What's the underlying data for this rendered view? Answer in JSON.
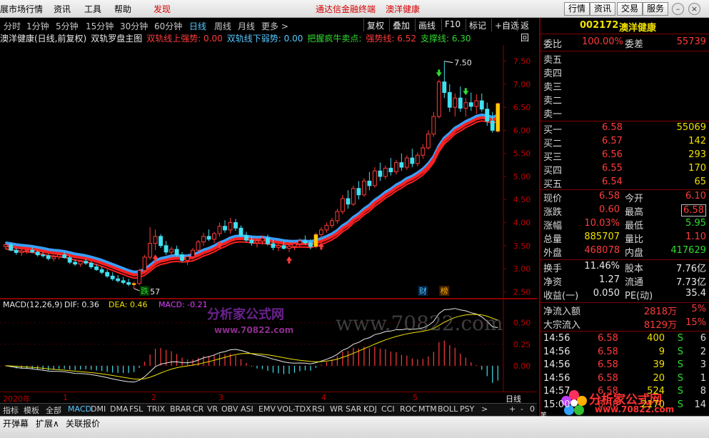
{
  "menu": {
    "items": [
      "展市场行情",
      "资讯",
      "工具",
      "帮助"
    ],
    "discover": "发现",
    "app_title": "通达信金融终端",
    "stock_title": "澳洋健康",
    "right_buttons": [
      "行情",
      "资讯",
      "交易",
      "服务"
    ]
  },
  "periods": {
    "items": [
      "分时",
      "1分钟",
      "5分钟",
      "15分钟",
      "30分钟",
      "60分钟",
      "日线",
      "周线",
      "月线",
      "更多 >"
    ],
    "active": "日线",
    "toolbar": [
      "复权",
      "叠加",
      "画线",
      "F10",
      "标记",
      "+自选",
      "返回"
    ]
  },
  "chart_title": {
    "name": "澳洋健康(日线,前复权)",
    "indicator": "双轨罗盘主图",
    "items": [
      {
        "text": "双轨线上强势: 0.00",
        "color": "#ff3b3b"
      },
      {
        "text": "双轨线下弱势: 0.00",
        "color": "#56c8ff"
      },
      {
        "text": "把握疯牛卖点:",
        "color": "#2fdc2f"
      },
      {
        "text": "强势线: 6.52",
        "color": "#ff3b3b"
      },
      {
        "text": "支撑线: 6.30",
        "color": "#2fdc2f"
      }
    ]
  },
  "chart_data": [
    {
      "type": "candlestick",
      "yticks": [
        "7.50",
        "7.00",
        "6.50",
        "6.00",
        "5.50",
        "5.00",
        "4.50",
        "4.00",
        "3.50",
        "3.00",
        "2.50"
      ],
      "ylim": [
        2.35,
        7.85
      ],
      "annotations": {
        "high": "7.50",
        "low": "2.57"
      },
      "markers": [
        "跌",
        "财",
        "榜"
      ],
      "candles": [
        [
          3.48,
          3.58,
          3.42,
          3.52
        ],
        [
          3.52,
          3.56,
          3.38,
          3.4
        ],
        [
          3.4,
          3.45,
          3.3,
          3.35
        ],
        [
          3.35,
          3.42,
          3.28,
          3.38
        ],
        [
          3.38,
          3.44,
          3.32,
          3.4
        ],
        [
          3.4,
          3.46,
          3.34,
          3.36
        ],
        [
          3.36,
          3.4,
          3.26,
          3.3
        ],
        [
          3.3,
          3.36,
          3.24,
          3.28
        ],
        [
          3.28,
          3.32,
          3.18,
          3.22
        ],
        [
          3.22,
          3.3,
          3.16,
          3.26
        ],
        [
          3.26,
          3.34,
          3.2,
          3.3
        ],
        [
          3.3,
          3.36,
          3.22,
          3.24
        ],
        [
          3.24,
          3.28,
          3.1,
          3.14
        ],
        [
          3.14,
          3.2,
          3.06,
          3.1
        ],
        [
          3.1,
          3.18,
          3.04,
          3.16
        ],
        [
          3.16,
          3.22,
          3.08,
          3.12
        ],
        [
          3.12,
          3.16,
          3.0,
          3.04
        ],
        [
          3.04,
          3.1,
          2.95,
          2.98
        ],
        [
          2.98,
          3.04,
          2.88,
          2.92
        ],
        [
          2.92,
          2.98,
          2.8,
          2.84
        ],
        [
          2.84,
          2.92,
          2.74,
          2.78
        ],
        [
          2.78,
          2.86,
          2.7,
          2.74
        ],
        [
          2.74,
          2.82,
          2.66,
          2.7
        ],
        [
          2.7,
          2.78,
          2.62,
          2.66
        ],
        [
          2.66,
          2.72,
          2.57,
          2.68
        ],
        [
          2.68,
          3.0,
          2.64,
          2.96
        ],
        [
          2.96,
          3.3,
          2.92,
          3.25
        ],
        [
          3.25,
          3.9,
          3.2,
          3.55
        ],
        [
          3.55,
          3.85,
          3.4,
          3.7
        ],
        [
          3.7,
          3.75,
          3.45,
          3.5
        ],
        [
          3.5,
          3.6,
          3.3,
          3.36
        ],
        [
          3.36,
          3.48,
          3.2,
          3.42
        ],
        [
          3.42,
          3.5,
          3.26,
          3.3
        ],
        [
          3.3,
          3.36,
          3.14,
          3.18
        ],
        [
          3.18,
          3.3,
          3.08,
          3.26
        ],
        [
          3.26,
          3.45,
          3.2,
          3.4
        ],
        [
          3.4,
          3.62,
          3.36,
          3.58
        ],
        [
          3.58,
          3.78,
          3.5,
          3.7
        ],
        [
          3.7,
          3.85,
          3.6,
          3.64
        ],
        [
          3.64,
          3.8,
          3.56,
          3.76
        ],
        [
          3.76,
          4.0,
          3.7,
          3.92
        ],
        [
          3.92,
          4.05,
          3.78,
          3.84
        ],
        [
          3.84,
          4.1,
          3.76,
          4.0
        ],
        [
          4.0,
          4.08,
          3.82,
          3.88
        ],
        [
          3.88,
          3.94,
          3.68,
          3.72
        ],
        [
          3.72,
          3.8,
          3.58,
          3.62
        ],
        [
          3.62,
          3.7,
          3.5,
          3.56
        ],
        [
          3.56,
          3.66,
          3.46,
          3.6
        ],
        [
          3.6,
          3.72,
          3.52,
          3.66
        ],
        [
          3.66,
          3.74,
          3.5,
          3.54
        ],
        [
          3.54,
          3.62,
          3.4,
          3.46
        ],
        [
          3.46,
          3.56,
          3.38,
          3.5
        ],
        [
          3.5,
          3.6,
          3.42,
          3.44
        ],
        [
          3.44,
          3.52,
          3.36,
          3.48
        ],
        [
          3.48,
          3.58,
          3.4,
          3.54
        ],
        [
          3.54,
          3.66,
          3.48,
          3.6
        ],
        [
          3.6,
          3.72,
          3.52,
          3.56
        ],
        [
          3.56,
          3.64,
          3.42,
          3.48
        ],
        [
          3.48,
          3.78,
          3.44,
          3.74
        ],
        [
          3.74,
          3.9,
          3.66,
          3.84
        ],
        [
          3.84,
          4.0,
          3.78,
          3.94
        ],
        [
          3.94,
          4.1,
          3.88,
          4.04
        ],
        [
          4.04,
          4.3,
          3.98,
          4.24
        ],
        [
          4.24,
          4.6,
          4.18,
          4.52
        ],
        [
          4.52,
          4.7,
          4.3,
          4.4
        ],
        [
          4.4,
          4.8,
          4.36,
          4.74
        ],
        [
          4.74,
          4.9,
          4.5,
          4.6
        ],
        [
          4.6,
          4.96,
          4.56,
          4.9
        ],
        [
          4.9,
          5.1,
          4.7,
          4.8
        ],
        [
          4.8,
          5.2,
          4.76,
          5.12
        ],
        [
          5.12,
          5.3,
          4.9,
          5.0
        ],
        [
          5.0,
          5.24,
          4.94,
          5.18
        ],
        [
          5.18,
          5.4,
          5.02,
          5.1
        ],
        [
          5.1,
          5.36,
          5.04,
          5.3
        ],
        [
          5.3,
          5.5,
          5.12,
          5.2
        ],
        [
          5.2,
          5.46,
          5.14,
          5.4
        ],
        [
          5.4,
          5.6,
          5.2,
          5.28
        ],
        [
          5.28,
          5.52,
          5.22,
          5.46
        ],
        [
          5.46,
          5.7,
          5.38,
          5.62
        ],
        [
          5.62,
          6.0,
          5.58,
          5.92
        ],
        [
          5.92,
          6.4,
          5.86,
          6.3
        ],
        [
          6.3,
          7.1,
          6.26,
          7.05
        ],
        [
          7.05,
          7.5,
          6.7,
          6.82
        ],
        [
          6.82,
          7.0,
          6.4,
          6.5
        ],
        [
          6.5,
          6.8,
          6.3,
          6.7
        ],
        [
          6.7,
          6.95,
          6.4,
          6.48
        ],
        [
          6.48,
          6.7,
          6.3,
          6.6
        ],
        [
          6.6,
          6.82,
          6.42,
          6.52
        ],
        [
          6.52,
          6.78,
          6.36,
          6.64
        ],
        [
          6.64,
          6.8,
          6.4,
          6.46
        ],
        [
          6.46,
          6.6,
          6.1,
          6.2
        ],
        [
          6.2,
          6.4,
          5.95,
          6.0
        ],
        [
          5.98,
          6.6,
          5.95,
          6.58
        ]
      ]
    },
    {
      "type": "bar",
      "title": "MACD(12,26,9)",
      "series_labels": [
        {
          "text": "MACD(12,26,9)",
          "color": "#e8e8e8"
        },
        {
          "text": "DIF: 0.36",
          "color": "#e8e8e8"
        },
        {
          "text": "DEA: 0.46",
          "color": "#f0e000"
        },
        {
          "text": "MACD: -0.21",
          "color": "#e040ff"
        }
      ],
      "yticks": [
        "0.50",
        "0.25",
        "0.00"
      ],
      "ylim": [
        -0.3,
        0.78
      ]
    }
  ],
  "date_axis": {
    "year_label": "2020年",
    "months": [
      "1",
      "2",
      "3",
      "4",
      "5"
    ],
    "period_label": "日线"
  },
  "indicators": {
    "items": [
      "指标",
      "模板",
      "全部",
      "MACD",
      "DMI",
      "DMA",
      "FSL",
      "TRIX",
      "BRAR",
      "CR",
      "VR",
      "OBV",
      "ASI",
      "EMV",
      "VOL-TDX",
      "RSI",
      "WR",
      "SAR",
      "KDJ",
      "CCI",
      "ROC",
      "MTM",
      "BOLL",
      "PSY",
      ">"
    ],
    "active": "MACD",
    "controls": [
      "+",
      "-",
      "0"
    ]
  },
  "bottom_tabs": [
    "开弹幕",
    "扩展∧",
    "关联报价"
  ],
  "quote": {
    "code": "002172",
    "name": "澳洋健康",
    "wei_bi_label": "委比",
    "wei_bi": "100.00%",
    "wei_cha_label": "委差",
    "wei_cha": "55739",
    "sell": [
      {
        "label": "卖五"
      },
      {
        "label": "卖四"
      },
      {
        "label": "卖三"
      },
      {
        "label": "卖二"
      },
      {
        "label": "卖一"
      }
    ],
    "buy": [
      {
        "label": "买一",
        "price": "6.58",
        "vol": "55069"
      },
      {
        "label": "买二",
        "price": "6.57",
        "vol": "142"
      },
      {
        "label": "买三",
        "price": "6.56",
        "vol": "293"
      },
      {
        "label": "买四",
        "price": "6.55",
        "vol": "170"
      },
      {
        "label": "买五",
        "price": "6.54",
        "vol": "65"
      }
    ],
    "stats": [
      {
        "l1": "现价",
        "v1": "6.58",
        "c1": "red",
        "l2": "今开",
        "v2": "6.10",
        "c2": "red"
      },
      {
        "l1": "涨跌",
        "v1": "0.60",
        "c1": "red",
        "l2": "最高",
        "v2": "6.58",
        "c2": "red",
        "box2": true
      },
      {
        "l1": "涨幅",
        "v1": "10.03%",
        "c1": "red",
        "l2": "最低",
        "v2": "5.95",
        "c2": "grn"
      },
      {
        "l1": "总量",
        "v1": "885707",
        "c1": "yel",
        "l2": "量比",
        "v2": "1.10",
        "c2": "red"
      },
      {
        "l1": "外盘",
        "v1": "468078",
        "c1": "red",
        "l2": "内盘",
        "v2": "417629",
        "c2": "grn"
      }
    ],
    "fund": [
      {
        "l1": "换手",
        "v1": "11.46%",
        "l2": "股本",
        "v2": "7.76亿"
      },
      {
        "l1": "净资",
        "v1": "1.27",
        "l2": "流通",
        "v2": "7.73亿"
      },
      {
        "l1": "收益(一)",
        "v1": "0.050",
        "l2": "PE(动)",
        "v2": "35.4"
      }
    ],
    "flow": [
      {
        "label": "净流入额",
        "value": "2818万",
        "pct": "5%"
      },
      {
        "label": "大宗流入",
        "value": "8129万",
        "pct": "15%"
      }
    ],
    "ticks": [
      {
        "time": "14:56",
        "price": "6.58",
        "vol": "400",
        "side": "S",
        "n": "6"
      },
      {
        "time": "14:56",
        "price": "6.58",
        "vol": "9",
        "side": "S",
        "n": "2"
      },
      {
        "time": "14:56",
        "price": "6.58",
        "vol": "39",
        "side": "S",
        "n": "3"
      },
      {
        "time": "14:56",
        "price": "6.58",
        "vol": "20",
        "side": "S",
        "n": "1"
      },
      {
        "time": "14:57",
        "price": "6.58",
        "vol": "524",
        "side": "S",
        "n": "8"
      },
      {
        "time": "15:00",
        "price": "6.58",
        "vol": "2170",
        "side": "S",
        "n": "14"
      }
    ],
    "side_tab": "笔"
  },
  "watermark": {
    "main": "分析家公式网",
    "url_a": "www.70822.com",
    "url_b": "www.70822.com"
  }
}
